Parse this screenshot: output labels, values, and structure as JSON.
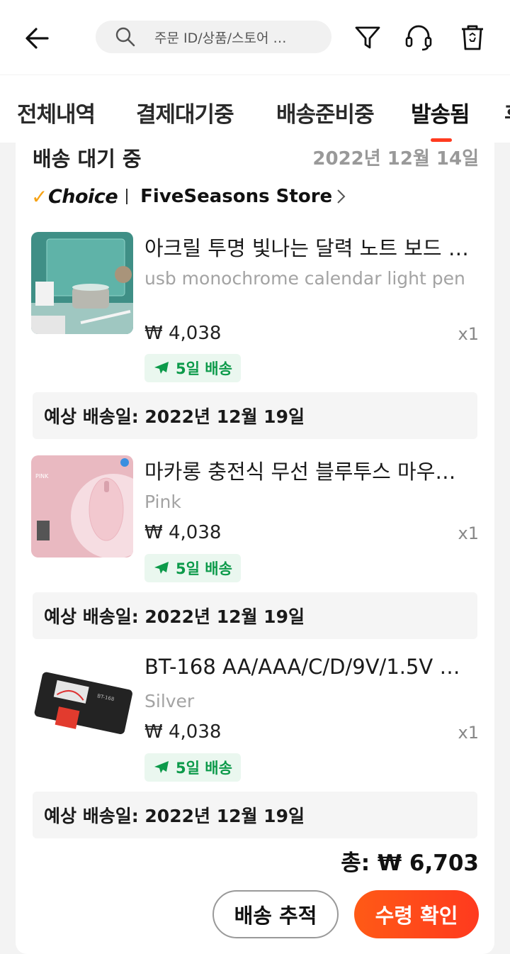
{
  "header": {
    "search_placeholder": "주문 ID/상품/스토어 …",
    "icons": [
      "back-arrow-icon",
      "search-icon",
      "filter-icon",
      "headset-icon",
      "trash-icon"
    ]
  },
  "tabs": [
    {
      "label": "전체내역"
    },
    {
      "label": "결제대기중"
    },
    {
      "label": "배송준비중"
    },
    {
      "label": "발송됨",
      "active": true
    },
    {
      "label": "후"
    }
  ],
  "order": {
    "status": "배송 대기 중",
    "date": "2022년 12월 14일",
    "choice_label": "Choice",
    "store_name": "FiveSeasons Store",
    "items": [
      {
        "name": "아크릴 투명 빛나는 달력 노트 보드 …",
        "variant": "usb monochrome   calendar light pen",
        "price": "₩ 4,038",
        "qty": "x1",
        "shipping": "5일 배송",
        "eta": "예상 배송일: 2022년 12월 19일"
      },
      {
        "name": "마카롱 충전식 무선 블루투스 마우…",
        "variant": "Pink",
        "price": "₩ 4,038",
        "qty": "x1",
        "shipping": "5일 배송",
        "eta": "예상 배송일: 2022년 12월 19일"
      },
      {
        "name": "BT-168 AA/AAA/C/D/9V/1.5V …",
        "variant": "Silver",
        "price": "₩ 4,038",
        "qty": "x1",
        "shipping": "5일 배송",
        "eta": "예상 배송일: 2022년 12월 19일"
      }
    ],
    "total": "총: ₩ 6,703",
    "track_button": "배송 추적",
    "confirm_button": "수령 확인"
  },
  "colors": {
    "accent": "#ff4a1a",
    "shipping_green": "#0c9a4a",
    "choice_check": "#f6a214"
  }
}
